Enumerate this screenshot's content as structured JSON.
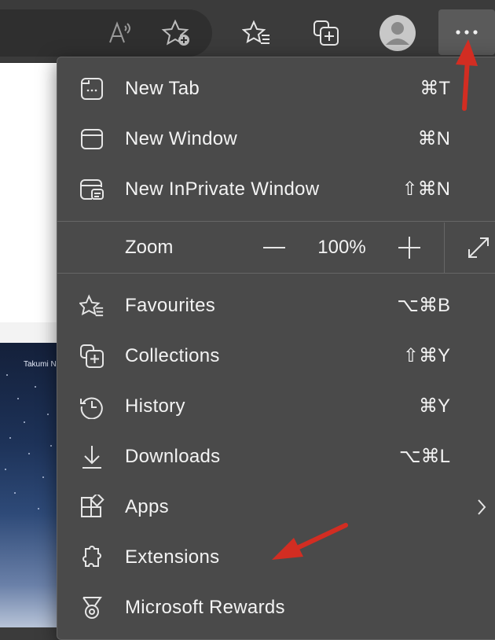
{
  "colors": {
    "menu_bg": "#4a4a4a",
    "toolbar_bg": "#3b3b3b",
    "text": "#f3f3f3",
    "annotation_arrow": "#d22d22"
  },
  "toolbar": {
    "icons": [
      "read-aloud-icon",
      "add-favourite-icon",
      "favourites-icon",
      "collections-icon",
      "profile-avatar-icon",
      "more-options-icon"
    ]
  },
  "page": {
    "caption": "Takumi N"
  },
  "menu": {
    "items_top": [
      {
        "label": "New Tab",
        "shortcut": "⌘T",
        "icon": "new-tab-icon"
      },
      {
        "label": "New Window",
        "shortcut": "⌘N",
        "icon": "new-window-icon"
      },
      {
        "label": "New InPrivate Window",
        "shortcut": "⇧⌘N",
        "icon": "inprivate-window-icon"
      }
    ],
    "zoom": {
      "label": "Zoom",
      "value": "100%",
      "decrease_icon": "minus-icon",
      "increase_icon": "plus-icon",
      "fullscreen_icon": "fullscreen-expand-icon"
    },
    "items_bottom": [
      {
        "label": "Favourites",
        "shortcut": "⌥⌘B",
        "icon": "favourites-icon"
      },
      {
        "label": "Collections",
        "shortcut": "⇧⌘Y",
        "icon": "collections-icon"
      },
      {
        "label": "History",
        "shortcut": "⌘Y",
        "icon": "history-icon"
      },
      {
        "label": "Downloads",
        "shortcut": "⌥⌘L",
        "icon": "download-icon"
      },
      {
        "label": "Apps",
        "shortcut": "",
        "icon": "apps-icon",
        "submenu": true
      },
      {
        "label": "Extensions",
        "shortcut": "",
        "icon": "extensions-icon"
      },
      {
        "label": "Microsoft Rewards",
        "shortcut": "",
        "icon": "rewards-medal-icon"
      }
    ]
  }
}
